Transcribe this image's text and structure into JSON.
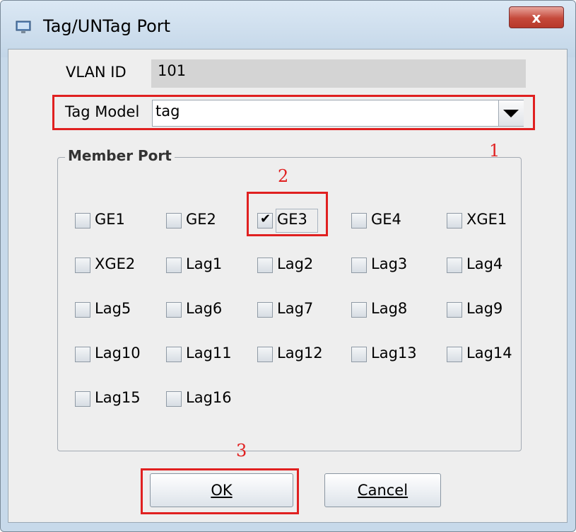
{
  "window": {
    "title": "Tag/UNTag Port",
    "close_label": "x",
    "icon": "network-adapter-icon"
  },
  "form": {
    "vlan_label": "VLAN ID",
    "vlan_value": "101",
    "tag_label": "Tag Model",
    "tag_value": "tag"
  },
  "member_port": {
    "title": "Member Port",
    "ports": [
      {
        "label": "GE1",
        "checked": false
      },
      {
        "label": "GE2",
        "checked": false
      },
      {
        "label": "GE3",
        "checked": true
      },
      {
        "label": "GE4",
        "checked": false
      },
      {
        "label": "XGE1",
        "checked": false
      },
      {
        "label": "XGE2",
        "checked": false
      },
      {
        "label": "Lag1",
        "checked": false
      },
      {
        "label": "Lag2",
        "checked": false
      },
      {
        "label": "Lag3",
        "checked": false
      },
      {
        "label": "Lag4",
        "checked": false
      },
      {
        "label": "Lag5",
        "checked": false
      },
      {
        "label": "Lag6",
        "checked": false
      },
      {
        "label": "Lag7",
        "checked": false
      },
      {
        "label": "Lag8",
        "checked": false
      },
      {
        "label": "Lag9",
        "checked": false
      },
      {
        "label": "Lag10",
        "checked": false
      },
      {
        "label": "Lag11",
        "checked": false
      },
      {
        "label": "Lag12",
        "checked": false
      },
      {
        "label": "Lag13",
        "checked": false
      },
      {
        "label": "Lag14",
        "checked": false
      },
      {
        "label": "Lag15",
        "checked": false
      },
      {
        "label": "Lag16",
        "checked": false
      }
    ]
  },
  "buttons": {
    "ok": "OK",
    "cancel": "Cancel"
  },
  "annotations": {
    "one": "1",
    "two": "2",
    "three": "3"
  },
  "colors": {
    "annotation": "#e02020",
    "title_bar": "#c7d9ea",
    "close_button": "#c5493a"
  }
}
